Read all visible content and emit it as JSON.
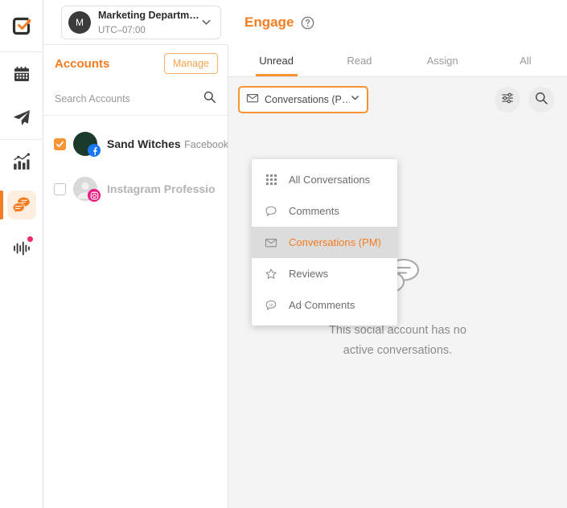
{
  "colors": {
    "accent": "#F57C20",
    "accent_light": "#F79433",
    "panel_bg": "#F4F4F4",
    "facebook": "#1877F2",
    "instagram": "#E8197F",
    "badge_dot": "#F0296B"
  },
  "rail": {
    "logo_name": "app-logo-checkmark-arrow",
    "items": [
      {
        "icon": "calendar-icon",
        "name": "rail-item-calendar",
        "active": false,
        "badge": false
      },
      {
        "icon": "paper-plane-icon",
        "name": "rail-item-publish",
        "active": false,
        "badge": false
      },
      {
        "icon": "analytics-chart-icon",
        "name": "rail-item-analytics",
        "active": false,
        "badge": false
      },
      {
        "icon": "chat-bubbles-icon",
        "name": "rail-item-engage",
        "active": true,
        "badge": false
      },
      {
        "icon": "soundwave-icon",
        "name": "rail-item-listening",
        "active": false,
        "badge": true
      }
    ]
  },
  "workspace": {
    "avatar_initial": "M",
    "name": "Marketing Departm…",
    "timezone": "UTC–07:00",
    "chevron_icon": "chevron-down-icon"
  },
  "accounts": {
    "title": "Accounts",
    "manage_label": "Manage",
    "search_placeholder": "Search Accounts",
    "search_value": "",
    "search_icon": "search-icon",
    "items": [
      {
        "name": "Sand Witches",
        "type": "Facebook Page",
        "network": "facebook",
        "checked": true,
        "enabled": true
      },
      {
        "name": "Instagram Professio",
        "type": "",
        "network": "instagram",
        "checked": false,
        "enabled": false
      }
    ]
  },
  "main": {
    "title": "Engage",
    "help_icon": "help-circle-icon",
    "tabs": [
      {
        "label": "Unread",
        "active": true
      },
      {
        "label": "Read",
        "active": false
      },
      {
        "label": "Assign",
        "active": false
      },
      {
        "label": "All",
        "active": false
      }
    ],
    "type_filter": {
      "icon": "envelope-icon",
      "selected_label": "Conversations (P…",
      "chevron_icon": "chevron-down-icon"
    },
    "actions": [
      {
        "icon": "filter-sliders-icon",
        "name": "filter-button"
      },
      {
        "icon": "search-icon",
        "name": "search-button"
      }
    ],
    "dropdown": {
      "open": true,
      "items": [
        {
          "label": "All Conversations",
          "icon": "grid-dots-icon",
          "selected": false
        },
        {
          "label": "Comments",
          "icon": "speech-bubble-icon",
          "selected": false
        },
        {
          "label": "Conversations (PM)",
          "icon": "envelope-icon",
          "selected": true
        },
        {
          "label": "Reviews",
          "icon": "star-outline-icon",
          "selected": false
        },
        {
          "label": "Ad Comments",
          "icon": "ad-bubble-icon",
          "selected": false
        }
      ]
    },
    "empty_state": {
      "icon": "two-chat-bubbles-icon",
      "line1": "This social account has no",
      "line2": "active conversations."
    }
  }
}
